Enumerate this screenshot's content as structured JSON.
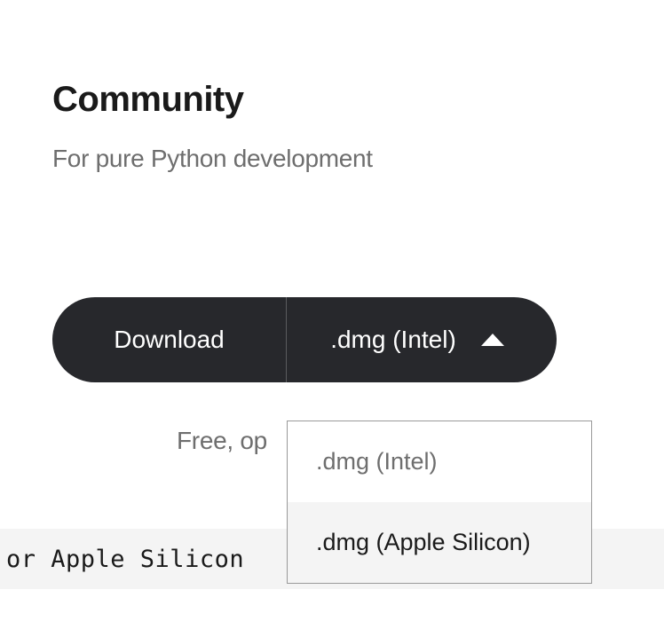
{
  "heading": "Community",
  "subtitle": "For pure Python development",
  "download": {
    "button_label": "Download",
    "selected_format": ".dmg (Intel)"
  },
  "free_text": "Free, op",
  "banner_text": "or Apple Silicon",
  "dropdown": {
    "options": [
      {
        "label": ".dmg (Intel)",
        "selected": false
      },
      {
        "label": ".dmg (Apple Silicon)",
        "selected": true
      }
    ]
  }
}
